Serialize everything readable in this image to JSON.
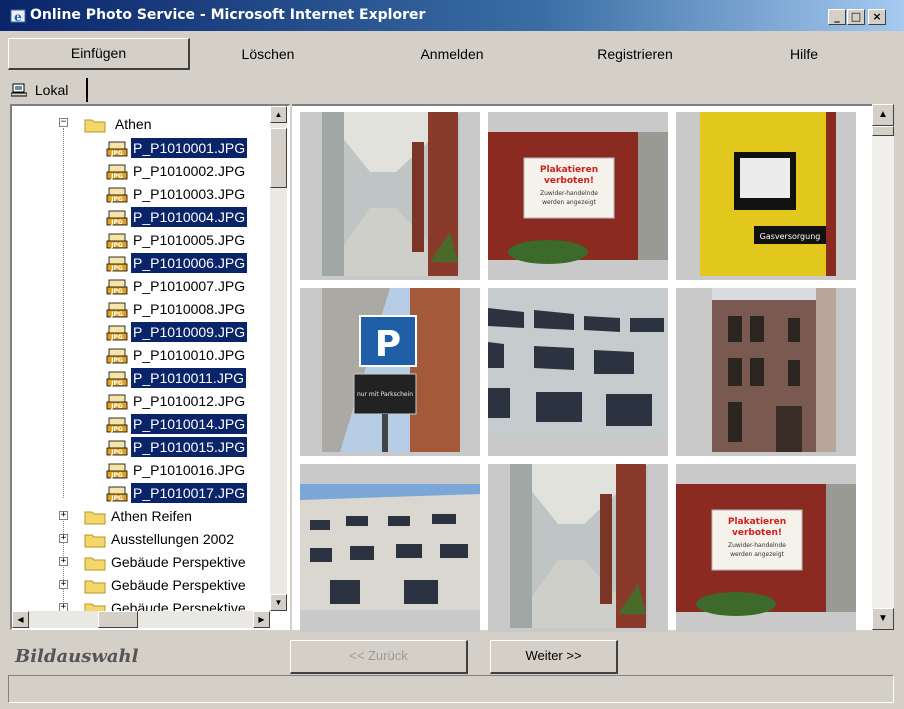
{
  "window": {
    "title": "Online Photo Service - Microsoft Internet Explorer",
    "minimize": "_",
    "maximize": "□",
    "close": "×"
  },
  "menu": {
    "items": [
      "Einfügen",
      "Löschen",
      "Anmelden",
      "Registrieren",
      "Hilfe"
    ],
    "active": "Einfügen"
  },
  "tabs": {
    "local": "Lokal"
  },
  "tree": {
    "root_folder": "Athen",
    "files": [
      {
        "name": "P_P1010001.JPG",
        "selected": true
      },
      {
        "name": "P_P1010002.JPG",
        "selected": false
      },
      {
        "name": "P_P1010003.JPG",
        "selected": false
      },
      {
        "name": "P_P1010004.JPG",
        "selected": true
      },
      {
        "name": "P_P1010005.JPG",
        "selected": false
      },
      {
        "name": "P_P1010006.JPG",
        "selected": true
      },
      {
        "name": "P_P1010007.JPG",
        "selected": false
      },
      {
        "name": "P_P1010008.JPG",
        "selected": false
      },
      {
        "name": "P_P1010009.JPG",
        "selected": true
      },
      {
        "name": "P_P1010010.JPG",
        "selected": false
      },
      {
        "name": "P_P1010011.JPG",
        "selected": true
      },
      {
        "name": "P_P1010012.JPG",
        "selected": false
      },
      {
        "name": "P_P1010014.JPG",
        "selected": true
      },
      {
        "name": "P_P1010015.JPG",
        "selected": true
      },
      {
        "name": "P_P1010016.JPG",
        "selected": false
      },
      {
        "name": "P_P1010017.JPG",
        "selected": true
      }
    ],
    "other_folders": [
      "Athen Reifen",
      "Ausstellungen 2002",
      "Gebäude Perspektive",
      "Gebäude Perspektive",
      "Gebäude Perspektive"
    ],
    "file_icon_text": "JPG"
  },
  "photos": {
    "sign_text": [
      "Plakatieren",
      "verboten!",
      "Zuwider-handelnde",
      "werden angezeigt"
    ],
    "yellow_box_text": "Gasversorgung",
    "parking_symbol": "P",
    "parking_sub": "nur mit Parkschein"
  },
  "bottom": {
    "label": "Bildauswahl",
    "back": "<< Zurück",
    "next": "Weiter >>"
  },
  "colors": {
    "title_start": "#0a246a",
    "selection": "#0a246a",
    "chrome": "#d4d0c8"
  }
}
